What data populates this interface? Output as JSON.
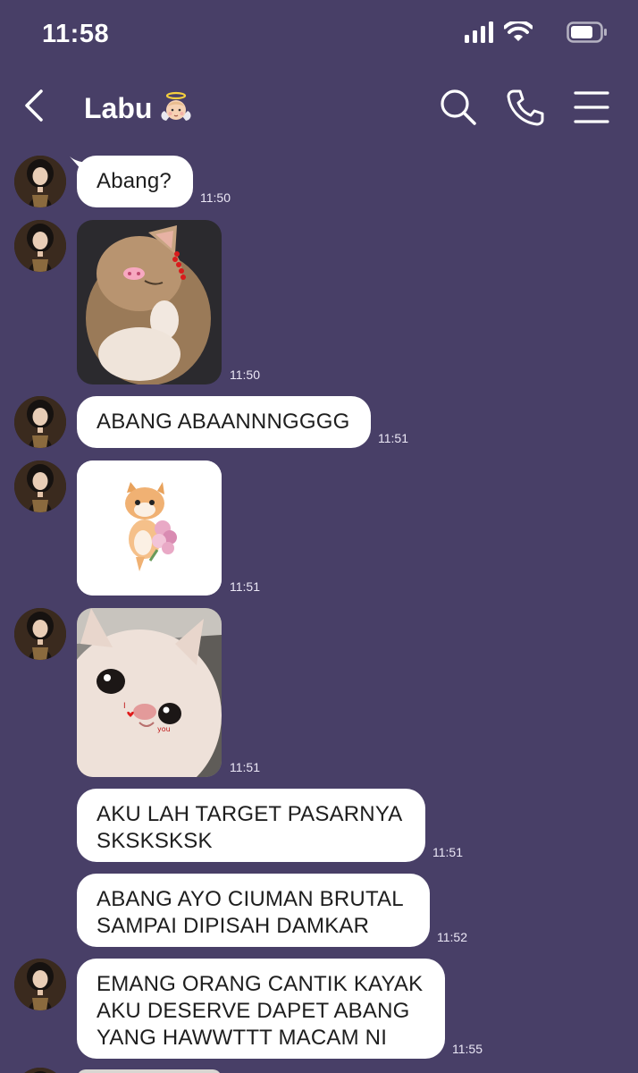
{
  "status": {
    "time": "11:58"
  },
  "header": {
    "title": "Labu",
    "title_emoji": "baby-angel-emoji"
  },
  "colors": {
    "background": "#483f67",
    "bubble": "#ffffff",
    "text": "#1e1e1e"
  },
  "messages": [
    {
      "type": "text",
      "text": "Abang?",
      "time": "11:50"
    },
    {
      "type": "sticker",
      "sticker": "kitten-with-pig-nose-sticker",
      "time": "11:50"
    },
    {
      "type": "text",
      "text": "ABANG ABAANNNGGGG",
      "time": "11:51"
    },
    {
      "type": "sticker",
      "sticker": "kitten-with-flowers-sticker",
      "time": "11:51"
    },
    {
      "type": "sticker",
      "sticker": "cat-closeup-i-love-you-sticker",
      "time": "11:51"
    },
    {
      "type": "text",
      "text": "AKU LAH TARGET PASARNYA\nSKSKSKSK",
      "time": "11:51"
    },
    {
      "type": "text",
      "text": "ABANG AYO CIUMAN BRUTAL\nSAMPAI DIPISAH DAMKAR",
      "time": "11:52"
    },
    {
      "type": "text",
      "text": "EMANG ORANG CANTIK KAYAK\nAKU DESERVE DAPET ABANG\nYANG HAWWTTT MACAM NI",
      "time": "11:55"
    }
  ]
}
